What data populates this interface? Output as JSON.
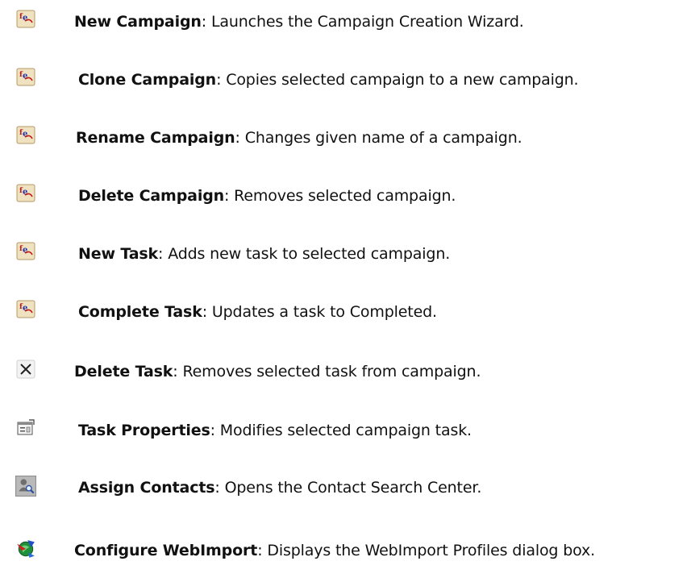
{
  "items": [
    {
      "name": "New Campaign",
      "separator": ": ",
      "description": "Launches the Campaign Creation Wizard.",
      "icon": "campaign-icon"
    },
    {
      "name": "Clone Campaign",
      "separator": ": ",
      "description": "Copies selected campaign to a new campaign.",
      "icon": "campaign-icon"
    },
    {
      "name": "Rename Campaign",
      "separator": ": ",
      "description": "Changes given name of a campaign.",
      "icon": "campaign-icon"
    },
    {
      "name": "Delete Campaign",
      "separator": ": ",
      "description": "Removes selected campaign.",
      "icon": "campaign-icon"
    },
    {
      "name": "New Task",
      "separator": ": ",
      "description": "Adds new task to selected campaign.",
      "icon": "campaign-icon"
    },
    {
      "name": "Complete Task",
      "separator": ": ",
      "description": "Updates a task to Completed.",
      "icon": "campaign-icon"
    },
    {
      "name": "Delete Task",
      "separator": ": ",
      "description": "Removes selected task from campaign.",
      "icon": "delete-x-icon"
    },
    {
      "name": "Task Properties",
      "separator": ": ",
      "description": "Modifies selected campaign task.",
      "icon": "properties-icon"
    },
    {
      "name": "Assign Contacts",
      "separator": ": ",
      "description": "Opens the Contact Search Center.",
      "icon": "contact-search-icon"
    },
    {
      "name": "Configure WebImport",
      "separator": ": ",
      "description": "Displays the WebImport Profiles dialog box.",
      "icon": "webimport-icon"
    }
  ]
}
